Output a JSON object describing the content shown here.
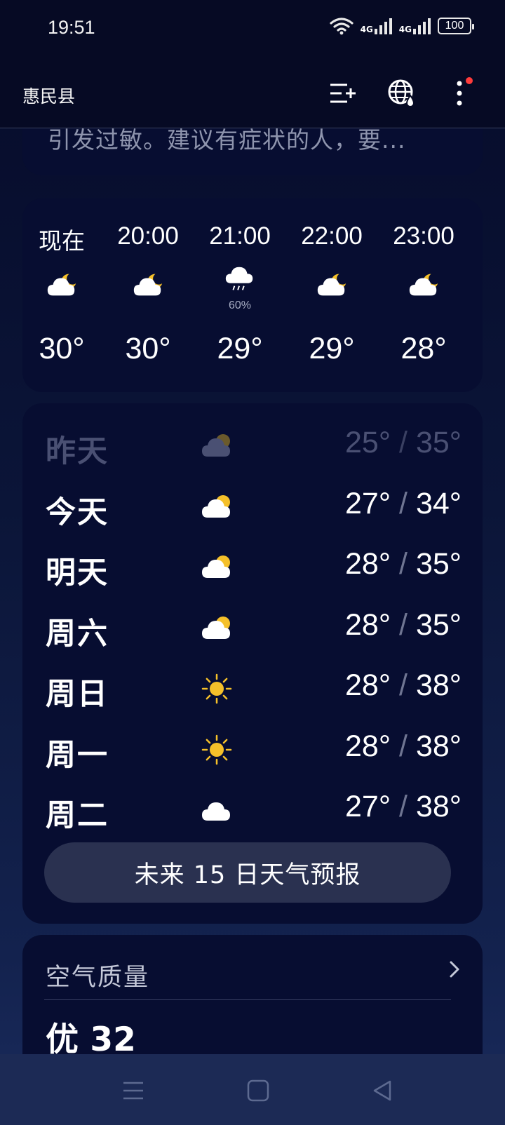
{
  "status_bar": {
    "time": "19:51",
    "network_1": "4G",
    "network_2": "4G",
    "battery": "100"
  },
  "header": {
    "city": "惠民县"
  },
  "alert": {
    "text": "引发过敏。建议有症状的人，要..."
  },
  "hourly": [
    {
      "time": "现在",
      "icon": "partly-cloudy-night-icon",
      "temp": "30°",
      "precip": ""
    },
    {
      "time": "20:00",
      "icon": "partly-cloudy-night-icon",
      "temp": "30°",
      "precip": ""
    },
    {
      "time": "21:00",
      "icon": "rain-icon",
      "temp": "29°",
      "precip": "60%"
    },
    {
      "time": "22:00",
      "icon": "partly-cloudy-night-icon",
      "temp": "29°",
      "precip": ""
    },
    {
      "time": "23:00",
      "icon": "partly-cloudy-night-icon",
      "temp": "28°",
      "precip": ""
    }
  ],
  "daily": [
    {
      "day": "昨天",
      "icon": "partly-cloudy-icon",
      "low": "25°",
      "high": "35°",
      "past": true
    },
    {
      "day": "今天",
      "icon": "partly-cloudy-icon",
      "low": "27°",
      "high": "34°",
      "past": false
    },
    {
      "day": "明天",
      "icon": "partly-cloudy-icon",
      "low": "28°",
      "high": "35°",
      "past": false
    },
    {
      "day": "周六",
      "icon": "partly-cloudy-icon",
      "low": "28°",
      "high": "35°",
      "past": false
    },
    {
      "day": "周日",
      "icon": "sunny-icon",
      "low": "28°",
      "high": "38°",
      "past": false
    },
    {
      "day": "周一",
      "icon": "sunny-icon",
      "low": "28°",
      "high": "38°",
      "past": false
    },
    {
      "day": "周二",
      "icon": "cloudy-icon",
      "low": "27°",
      "high": "38°",
      "past": false
    }
  ],
  "temp_separator": "/",
  "forecast_button": "未来 15 日天气预报",
  "air_quality": {
    "title": "空气质量",
    "value": "优 32"
  },
  "colors": {
    "background": "#0b1538",
    "card": "#070d31",
    "button": "#2a3150",
    "sun": "#f5c02a",
    "notification": "#ff3b3b"
  }
}
